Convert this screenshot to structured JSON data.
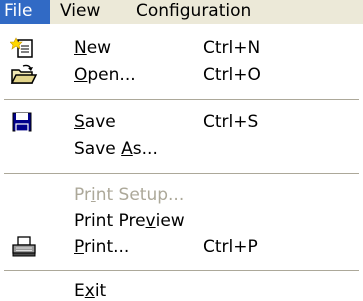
{
  "menubar": {
    "items": [
      {
        "label": "File",
        "active": true
      },
      {
        "label": "View"
      },
      {
        "label": "Configuration"
      }
    ]
  },
  "menu": {
    "new": {
      "pre": "",
      "key": "N",
      "post": "ew",
      "shortcut": "Ctrl+N",
      "icon": "new-document-icon"
    },
    "open": {
      "pre": "",
      "key": "O",
      "post": "pen...",
      "shortcut": "Ctrl+O",
      "icon": "open-folder-icon"
    },
    "save": {
      "pre": "",
      "key": "S",
      "post": "ave",
      "shortcut": "Ctrl+S",
      "icon": "floppy-disk-icon"
    },
    "save_as": {
      "pre": "Save ",
      "key": "A",
      "post": "s..."
    },
    "print_setup": {
      "pre": "Pr",
      "key": "i",
      "post": "nt Setup...",
      "disabled": true
    },
    "print_preview": {
      "pre": "Print Pre",
      "key": "v",
      "post": "iew"
    },
    "print": {
      "pre": "",
      "key": "P",
      "post": "rint...",
      "shortcut": "Ctrl+P",
      "icon": "printer-icon"
    },
    "exit": {
      "pre": "E",
      "key": "x",
      "post": "it"
    }
  },
  "colors": {
    "menubar_bg": "#ece9d8",
    "highlight": "#316ac5",
    "disabled_text": "#aca899"
  }
}
